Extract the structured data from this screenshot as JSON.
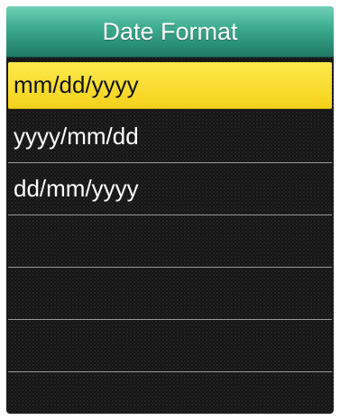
{
  "header": {
    "title": "Date Format"
  },
  "options": [
    {
      "label": "mm/dd/yyyy",
      "selected": true
    },
    {
      "label": "yyyy/mm/dd",
      "selected": false
    },
    {
      "label": "dd/mm/yyyy",
      "selected": false
    },
    {
      "label": "",
      "selected": false
    },
    {
      "label": "",
      "selected": false
    },
    {
      "label": "",
      "selected": false
    },
    {
      "label": "",
      "selected": false
    }
  ],
  "colors": {
    "header_green": "#3aa98e",
    "selection_yellow": "#f4d21c",
    "background": "#141414"
  }
}
